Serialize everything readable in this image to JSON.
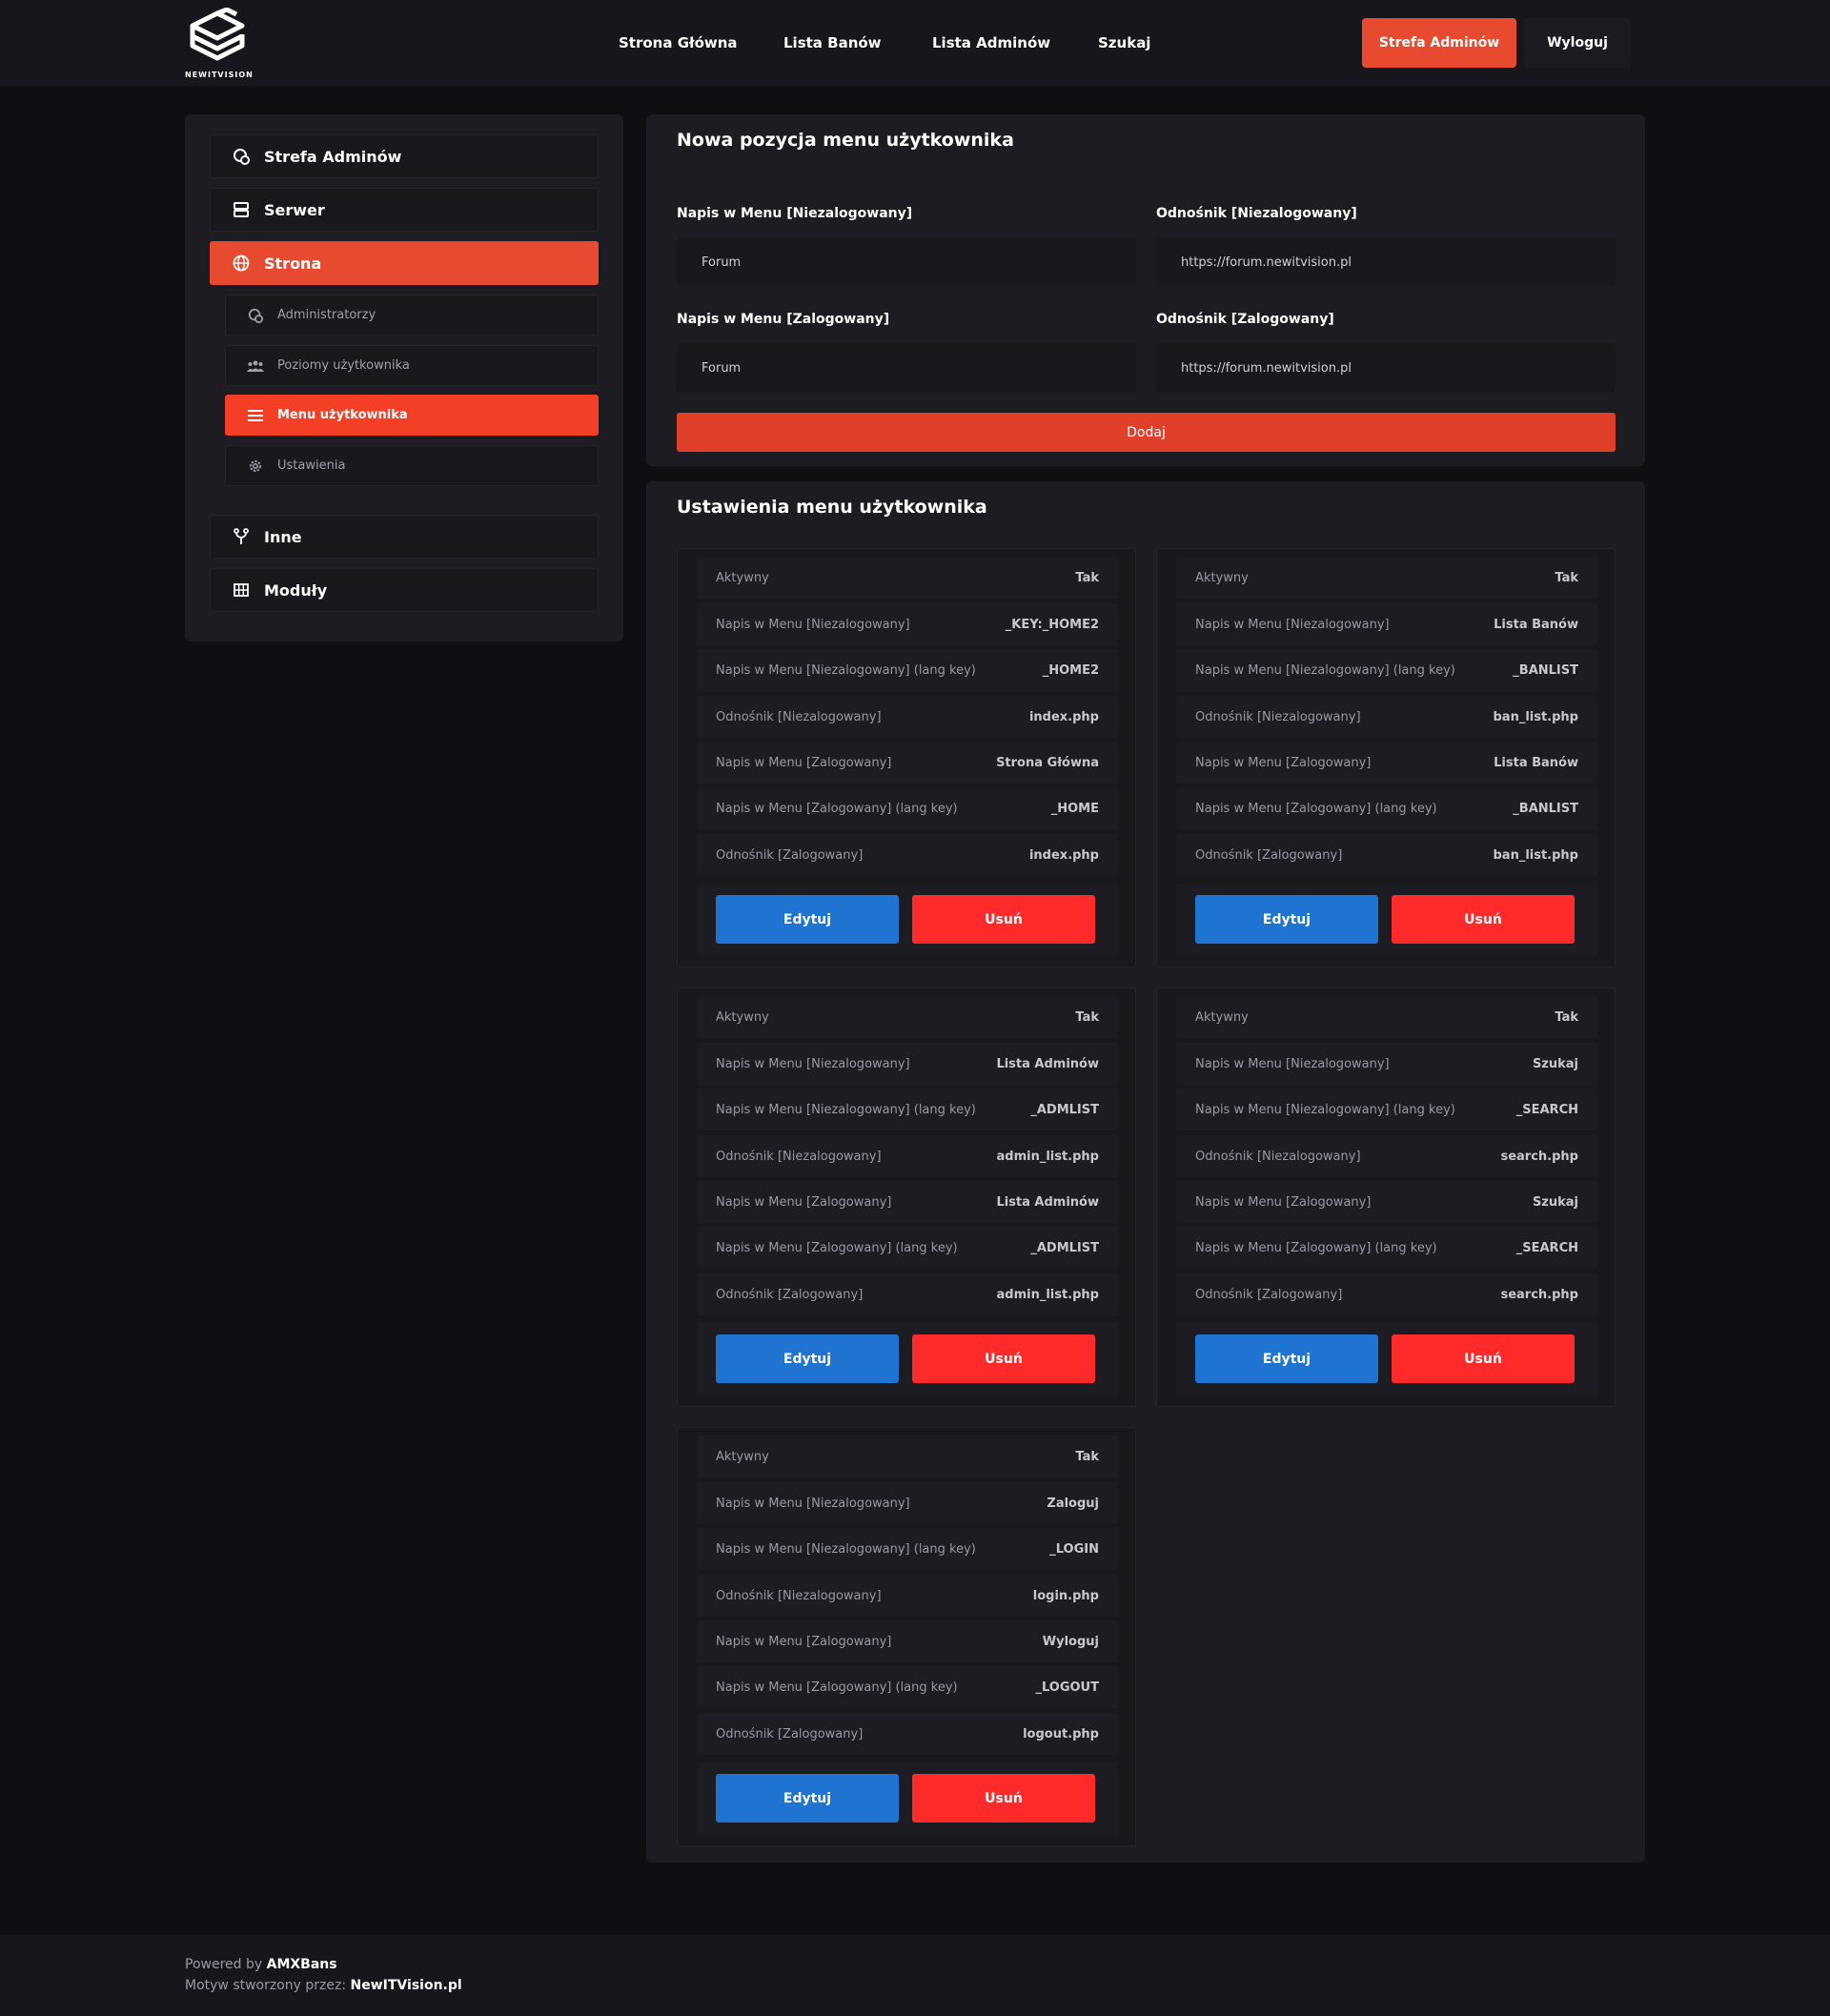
{
  "header": {
    "logo_text": "NEWITVISION",
    "nav": [
      "Strona Główna",
      "Lista Banów",
      "Lista Adminów",
      "Szukaj"
    ],
    "admin_button": "Strefa Adminów",
    "logout_button": "Wyloguj"
  },
  "sidebar": {
    "items": [
      {
        "label": "Strefa Adminów",
        "icon": "admin-shield-icon"
      },
      {
        "label": "Serwer",
        "icon": "server-icon"
      },
      {
        "label": "Strona",
        "icon": "globe-icon"
      }
    ],
    "sub_items": [
      {
        "label": "Administratorzy",
        "icon": "admin-shield-icon"
      },
      {
        "label": "Poziomy użytkownika",
        "icon": "users-icon"
      },
      {
        "label": "Menu użytkownika",
        "icon": "menu-icon"
      },
      {
        "label": "Ustawienia",
        "icon": "gear-icon"
      }
    ],
    "bottom_items": [
      {
        "label": "Inne",
        "icon": "fork-icon"
      },
      {
        "label": "Moduły",
        "icon": "grid-icon"
      }
    ],
    "active_item": "Strona",
    "active_sub_item": "Menu użytkownika"
  },
  "new_item": {
    "title": "Nowa pozycja menu użytkownika",
    "label_guest": "Napis w Menu [Niezalogowany]",
    "value_guest": "Forum",
    "link_guest_label": "Odnośnik [Niezalogowany]",
    "link_guest_value": "https://forum.newitvision.pl",
    "label_user": "Napis w Menu [Zalogowany]",
    "value_user": "Forum",
    "link_user_label": "Odnośnik [Zalogowany]",
    "link_user_value": "https://forum.newitvision.pl",
    "add_button": "Dodaj"
  },
  "settings": {
    "title": "Ustawienia menu użytkownika",
    "keys": [
      "Aktywny",
      "Napis w Menu [Niezalogowany]",
      "Napis w Menu [Niezalogowany] (lang key)",
      "Odnośnik [Niezalogowany]",
      "Napis w Menu [Zalogowany]",
      "Napis w Menu [Zalogowany] (lang key)",
      "Odnośnik [Zalogowany]"
    ],
    "edit_label": "Edytuj",
    "delete_label": "Usuń",
    "cards": [
      {
        "values": [
          "Tak",
          "_KEY:_HOME2",
          "_HOME2",
          "index.php",
          "Strona Główna",
          "_HOME",
          "index.php"
        ]
      },
      {
        "values": [
          "Tak",
          "Lista Banów",
          "_BANLIST",
          "ban_list.php",
          "Lista Banów",
          "_BANLIST",
          "ban_list.php"
        ]
      },
      {
        "values": [
          "Tak",
          "Lista Adminów",
          "_ADMLIST",
          "admin_list.php",
          "Lista Adminów",
          "_ADMLIST",
          "admin_list.php"
        ]
      },
      {
        "values": [
          "Tak",
          "Szukaj",
          "_SEARCH",
          "search.php",
          "Szukaj",
          "_SEARCH",
          "search.php"
        ]
      },
      {
        "values": [
          "Tak",
          "Zaloguj",
          "_LOGIN",
          "login.php",
          "Wyloguj",
          "_LOGOUT",
          "logout.php"
        ]
      }
    ]
  },
  "footer": {
    "powered_prefix": "Powered by",
    "powered_name": "AMXBans",
    "theme_prefix": "Motyw stworzony przez:",
    "theme_name": "NewITVision.pl"
  },
  "colors": {
    "accent": "#e84a2f",
    "edit_blue": "#1f74d2",
    "delete_red": "#ff2a2a",
    "background": "#0f0f13"
  }
}
